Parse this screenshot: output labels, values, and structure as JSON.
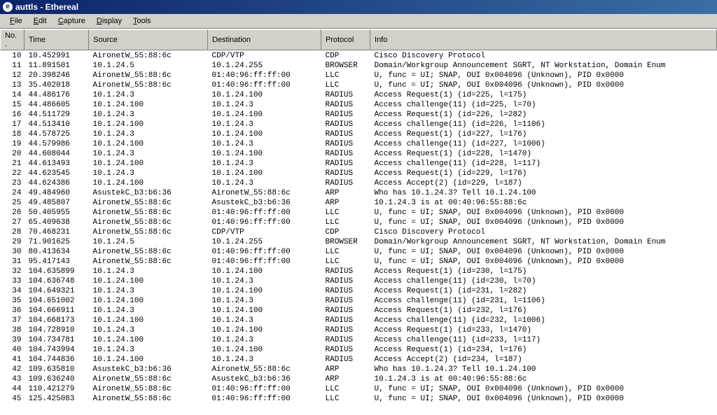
{
  "window": {
    "title": "auttls - Ethereal"
  },
  "menu": {
    "items": [
      "File",
      "Edit",
      "Capture",
      "Display",
      "Tools"
    ]
  },
  "columns": {
    "no": "No. .",
    "time": "Time",
    "source": "Source",
    "destination": "Destination",
    "protocol": "Protocol",
    "info": "Info"
  },
  "rows": [
    {
      "no": "10",
      "time": "10.452991",
      "src": "AironetW_55:88:6c",
      "dst": "CDP/VTP",
      "proto": "CDP",
      "info": "Cisco Discovery Protocol"
    },
    {
      "no": "11",
      "time": "11.891501",
      "src": "10.1.24.5",
      "dst": "10.1.24.255",
      "proto": "BROWSER",
      "info": "Domain/Workgroup Announcement SGRT, NT Workstation, Domain Enum"
    },
    {
      "no": "12",
      "time": "20.398246",
      "src": "AironetW_55:88:6c",
      "dst": "01:40:96:ff:ff:00",
      "proto": "LLC",
      "info": "U, func = UI; SNAP, OUI 0x004096 (Unknown), PID 0x0000"
    },
    {
      "no": "13",
      "time": "35.402018",
      "src": "AironetW_55:88:6c",
      "dst": "01:40:96:ff:ff:00",
      "proto": "LLC",
      "info": "U, func = UI; SNAP, OUI 0x004096 (Unknown), PID 0x0000"
    },
    {
      "no": "14",
      "time": "44.486176",
      "src": "10.1.24.3",
      "dst": "10.1.24.100",
      "proto": "RADIUS",
      "info": "Access Request(1) (id=225, l=175)"
    },
    {
      "no": "15",
      "time": "44.486605",
      "src": "10.1.24.100",
      "dst": "10.1.24.3",
      "proto": "RADIUS",
      "info": "Access challenge(11) (id=225, l=70)"
    },
    {
      "no": "16",
      "time": "44.511729",
      "src": "10.1.24.3",
      "dst": "10.1.24.100",
      "proto": "RADIUS",
      "info": "Access Request(1) (id=226, l=282)"
    },
    {
      "no": "17",
      "time": "44.513410",
      "src": "10.1.24.100",
      "dst": "10.1.24.3",
      "proto": "RADIUS",
      "info": "Access challenge(11) (id=226, l=1106)"
    },
    {
      "no": "18",
      "time": "44.578725",
      "src": "10.1.24.3",
      "dst": "10.1.24.100",
      "proto": "RADIUS",
      "info": "Access Request(1) (id=227, l=176)"
    },
    {
      "no": "19",
      "time": "44.579986",
      "src": "10.1.24.100",
      "dst": "10.1.24.3",
      "proto": "RADIUS",
      "info": "Access challenge(11) (id=227, l=1006)"
    },
    {
      "no": "20",
      "time": "44.608044",
      "src": "10.1.24.3",
      "dst": "10.1.24.100",
      "proto": "RADIUS",
      "info": "Access Request(1) (id=228, l=1470)"
    },
    {
      "no": "21",
      "time": "44.613493",
      "src": "10.1.24.100",
      "dst": "10.1.24.3",
      "proto": "RADIUS",
      "info": "Access challenge(11) (id=228, l=117)"
    },
    {
      "no": "22",
      "time": "44.623545",
      "src": "10.1.24.3",
      "dst": "10.1.24.100",
      "proto": "RADIUS",
      "info": "Access Request(1) (id=229, l=176)"
    },
    {
      "no": "23",
      "time": "44.624386",
      "src": "10.1.24.100",
      "dst": "10.1.24.3",
      "proto": "RADIUS",
      "info": "Access Accept(2) (id=229, l=187)"
    },
    {
      "no": "24",
      "time": "49.484960",
      "src": "AsustekC_b3:b6:36",
      "dst": "AironetW_55:88:6c",
      "proto": "ARP",
      "info": "Who has 10.1.24.3?  Tell 10.1.24.100"
    },
    {
      "no": "25",
      "time": "49.485807",
      "src": "AironetW_55:88:6c",
      "dst": "AsustekC_b3:b6:36",
      "proto": "ARP",
      "info": "10.1.24.3 is at 00:40:96:55:88:6c"
    },
    {
      "no": "26",
      "time": "50.405955",
      "src": "AironetW_55:88:6c",
      "dst": "01:40:96:ff:ff:00",
      "proto": "LLC",
      "info": "U, func = UI; SNAP, OUI 0x004096 (Unknown), PID 0x0000"
    },
    {
      "no": "27",
      "time": "65.409638",
      "src": "AironetW_55:88:6c",
      "dst": "01:40:96:ff:ff:00",
      "proto": "LLC",
      "info": "U, func = UI; SNAP, OUI 0x004096 (Unknown), PID 0x0000"
    },
    {
      "no": "28",
      "time": "70.468231",
      "src": "AironetW_55:88:6c",
      "dst": "CDP/VTP",
      "proto": "CDP",
      "info": "Cisco Discovery Protocol"
    },
    {
      "no": "29",
      "time": "71.901625",
      "src": "10.1.24.5",
      "dst": "10.1.24.255",
      "proto": "BROWSER",
      "info": "Domain/Workgroup Announcement SGRT, NT Workstation, Domain Enum"
    },
    {
      "no": "30",
      "time": "80.413634",
      "src": "AironetW_55:88:6c",
      "dst": "01:40:96:ff:ff:00",
      "proto": "LLC",
      "info": "U, func = UI; SNAP, OUI 0x004096 (Unknown), PID 0x0000"
    },
    {
      "no": "31",
      "time": "95.417143",
      "src": "AironetW_55:88:6c",
      "dst": "01:40:96:ff:ff:00",
      "proto": "LLC",
      "info": "U, func = UI; SNAP, OUI 0x004096 (Unknown), PID 0x0000"
    },
    {
      "no": "32",
      "time": "104.635899",
      "src": "10.1.24.3",
      "dst": "10.1.24.100",
      "proto": "RADIUS",
      "info": "Access Request(1) (id=230, l=175)"
    },
    {
      "no": "33",
      "time": "104.636748",
      "src": "10.1.24.100",
      "dst": "10.1.24.3",
      "proto": "RADIUS",
      "info": "Access challenge(11) (id=230, l=70)"
    },
    {
      "no": "34",
      "time": "104.649321",
      "src": "10.1.24.3",
      "dst": "10.1.24.100",
      "proto": "RADIUS",
      "info": "Access Request(1) (id=231, l=282)"
    },
    {
      "no": "35",
      "time": "104.651002",
      "src": "10.1.24.100",
      "dst": "10.1.24.3",
      "proto": "RADIUS",
      "info": "Access challenge(11) (id=231, l=1106)"
    },
    {
      "no": "36",
      "time": "104.666911",
      "src": "10.1.24.3",
      "dst": "10.1.24.100",
      "proto": "RADIUS",
      "info": "Access Request(1) (id=232, l=176)"
    },
    {
      "no": "37",
      "time": "104.668173",
      "src": "10.1.24.100",
      "dst": "10.1.24.3",
      "proto": "RADIUS",
      "info": "Access challenge(11) (id=232, l=1006)"
    },
    {
      "no": "38",
      "time": "104.728910",
      "src": "10.1.24.3",
      "dst": "10.1.24.100",
      "proto": "RADIUS",
      "info": "Access Request(1) (id=233, l=1470)"
    },
    {
      "no": "39",
      "time": "104.734781",
      "src": "10.1.24.100",
      "dst": "10.1.24.3",
      "proto": "RADIUS",
      "info": "Access challenge(11) (id=233, l=117)"
    },
    {
      "no": "40",
      "time": "104.743994",
      "src": "10.1.24.3",
      "dst": "10.1.24.100",
      "proto": "RADIUS",
      "info": "Access Request(1) (id=234, l=176)"
    },
    {
      "no": "41",
      "time": "104.744836",
      "src": "10.1.24.100",
      "dst": "10.1.24.3",
      "proto": "RADIUS",
      "info": "Access Accept(2) (id=234, l=187)"
    },
    {
      "no": "42",
      "time": "109.635810",
      "src": "AsustekC_b3:b6:36",
      "dst": "AironetW_55:88:6c",
      "proto": "ARP",
      "info": "Who has 10.1.24.3?  Tell 10.1.24.100"
    },
    {
      "no": "43",
      "time": "109.636240",
      "src": "AironetW_55:88:6c",
      "dst": "AsustekC_b3:b6:36",
      "proto": "ARP",
      "info": "10.1.24.3 is at 00:40:96:55:88:6c"
    },
    {
      "no": "44",
      "time": "110.421279",
      "src": "AironetW_55:88:6c",
      "dst": "01:40:96:ff:ff:00",
      "proto": "LLC",
      "info": "U, func = UI; SNAP, OUI 0x004096 (Unknown), PID 0x0000"
    },
    {
      "no": "45",
      "time": "125.425083",
      "src": "AironetW_55:88:6c",
      "dst": "01:40:96:ff:ff:00",
      "proto": "LLC",
      "info": "U, func = UI; SNAP, OUI 0x004096 (Unknown), PID 0x0000"
    }
  ]
}
